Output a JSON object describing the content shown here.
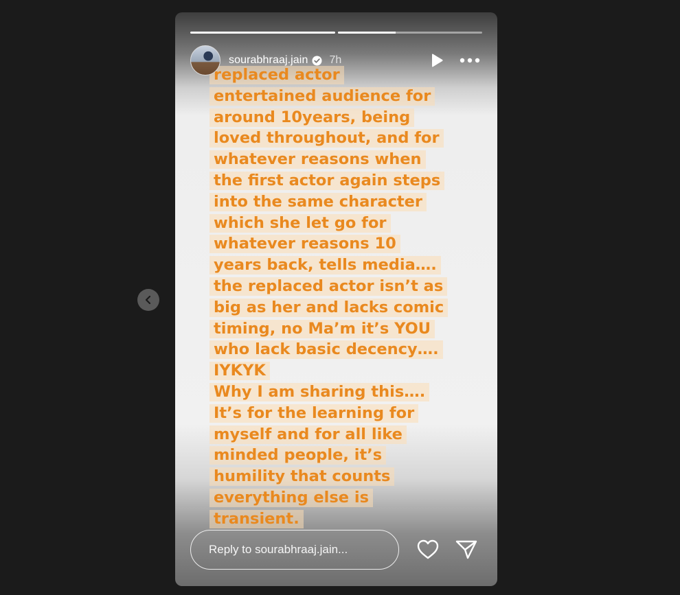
{
  "colors": {
    "background": "#1b1b1b",
    "story_text": "#e9891f",
    "text_highlight": "#fcdcb4"
  },
  "navigation": {
    "prev_icon": "chevron-left-icon"
  },
  "story": {
    "progress": [
      1.0,
      0.4
    ],
    "header": {
      "avatar_icon": "avatar",
      "username": "sourabhraaj.jain",
      "verified_icon": "verified-badge-icon",
      "time": "7h",
      "play_icon": "play-icon",
      "more_icon": "more-horizontal-icon"
    },
    "text_lines": [
      "replaced actor",
      "entertained audience for",
      "around 10years, being",
      "loved throughout, and for",
      "whatever reasons when",
      "the first actor again steps",
      "into the same character",
      "which she let go for",
      "whatever reasons 10",
      "years back, tells media….",
      "the replaced actor isn’t as",
      "big as her and lacks comic",
      "timing, no Ma’m it’s YOU",
      "who lack basic decency….",
      "IYKYK",
      "Why I am sharing this….",
      "It’s for the learning for",
      "myself and for all like",
      "minded people, it’s",
      "humility that counts",
      "everything else is",
      "transient."
    ],
    "footer": {
      "reply_placeholder": "Reply to sourabhraaj.jain...",
      "like_icon": "heart-icon",
      "share_icon": "send-icon"
    }
  }
}
